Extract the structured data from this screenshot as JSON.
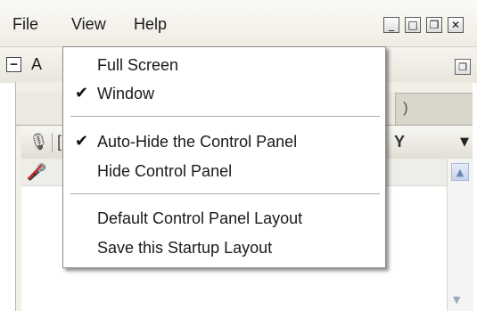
{
  "menubar": {
    "items": [
      "File",
      "View",
      "Help"
    ]
  },
  "window_controls": {
    "minimize": "_",
    "maximize": "□",
    "restore": "❐",
    "close": "✕"
  },
  "panel": {
    "label": "A",
    "collapse_glyph": "−",
    "restore_glyph": "❐"
  },
  "tabs": {
    "left_partial": "",
    "right_partial": ")"
  },
  "table": {
    "column_partial_left": "[",
    "column_partial_right": "Y",
    "sort_glyph": "▼",
    "mic_icon": "mic-icon",
    "row_icon": "muted-participant-icon"
  },
  "dropdown": {
    "items": [
      {
        "label": "Full Screen",
        "checked": false
      },
      {
        "label": "Window",
        "checked": true
      },
      {
        "label": "Auto-Hide the Control Panel",
        "checked": true
      },
      {
        "label": "Hide Control Panel",
        "checked": false
      },
      {
        "label": "Default Control Panel Layout",
        "checked": false
      },
      {
        "label": "Save this Startup Layout",
        "checked": false
      }
    ],
    "check_glyph": "✔"
  },
  "colors": {
    "menubar_bg": "#f2efe6",
    "menu_border": "#8d8d8d",
    "scroll_accent": "#c6d5ef"
  }
}
